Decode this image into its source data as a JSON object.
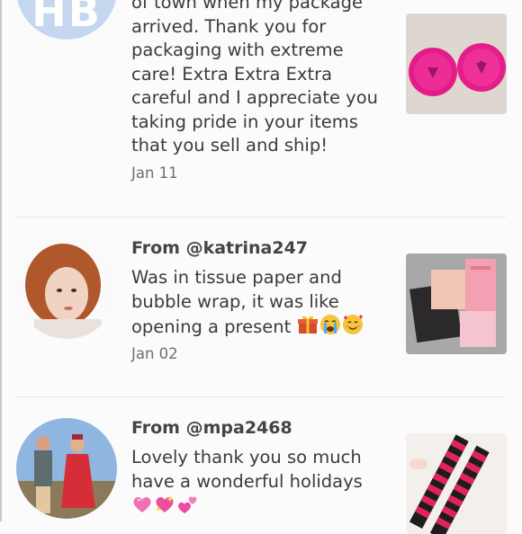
{
  "reviews": [
    {
      "avatar_initials": "HB",
      "from": "",
      "text": "of town when my package arrived. Thank you for packaging with extreme care! Extra Extra Extra careful and I appreciate you taking pride in your items that you sell and ship!",
      "date": "Jan 11",
      "thumbnail": "pink-compact-cases-photo"
    },
    {
      "from": "From @katrina247",
      "text": "Was in tissue paper and bubble wrap, it was like opening a present",
      "emoji": [
        "gift-emoji",
        "crying-face-emoji",
        "smiling-face-with-hearts-emoji"
      ],
      "date": "Jan 02",
      "thumbnail": "beauty-boxes-photo"
    },
    {
      "from": "From @mpa2468",
      "text": "Lovely thank you so much have a wonderful holidays",
      "emoji": [
        "pink-heart-emoji",
        "sparkling-heart-emoji",
        "two-hearts-emoji"
      ],
      "date": "",
      "thumbnail": "striped-stockings-photo"
    }
  ],
  "colors": {
    "background": "#fcfbfc",
    "divider": "#e6e6e6",
    "avatar_initials_bg": "#c5d7ee"
  }
}
